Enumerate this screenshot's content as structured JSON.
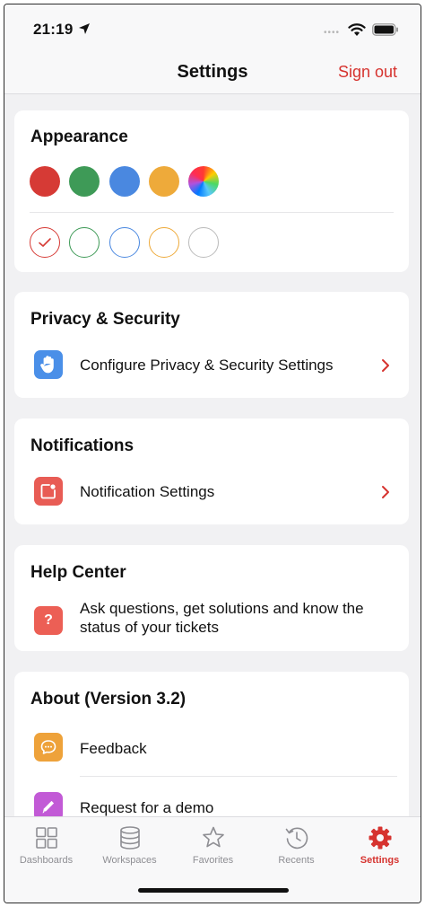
{
  "status_bar": {
    "time": "21:19",
    "signal_dots": "••••"
  },
  "nav": {
    "title": "Settings",
    "sign_out": "Sign out"
  },
  "appearance": {
    "title": "Appearance",
    "filled_colors": [
      "#d63a35",
      "#3e9a57",
      "#4a88e0",
      "#eeaa3a",
      "rainbow"
    ],
    "outline_colors": [
      "#d63a35",
      "#3e9a57",
      "#4a88e0",
      "#eeaa3a",
      "#bbbbbb"
    ],
    "selected_outline_index": 0
  },
  "privacy": {
    "title": "Privacy & Security",
    "item_label": "Configure Privacy & Security Settings",
    "icon": "hand-icon",
    "icon_color": "#4a8fe8"
  },
  "notifications": {
    "title": "Notifications",
    "item_label": "Notification Settings",
    "icon": "notification-icon",
    "icon_color": "#e85c55"
  },
  "help": {
    "title": "Help Center",
    "item_line1": "Ask questions, get solutions and know the",
    "item_line2": "status of your tickets",
    "icon_text": "?",
    "icon_color": "#ec5f55"
  },
  "about": {
    "title": "About (Version 3.2)",
    "items": [
      {
        "label": "Feedback",
        "icon": "chat-icon",
        "icon_color": "#eea23a"
      },
      {
        "label": "Request for a demo",
        "icon": "pencil-icon",
        "icon_color": "#c25ad6"
      }
    ]
  },
  "tabbar": {
    "tabs": [
      {
        "label": "Dashboards",
        "icon": "dashboard-icon"
      },
      {
        "label": "Workspaces",
        "icon": "database-icon"
      },
      {
        "label": "Favorites",
        "icon": "star-icon"
      },
      {
        "label": "Recents",
        "icon": "history-icon"
      },
      {
        "label": "Settings",
        "icon": "gear-icon",
        "active": true
      }
    ],
    "active_color": "#d6332f"
  }
}
